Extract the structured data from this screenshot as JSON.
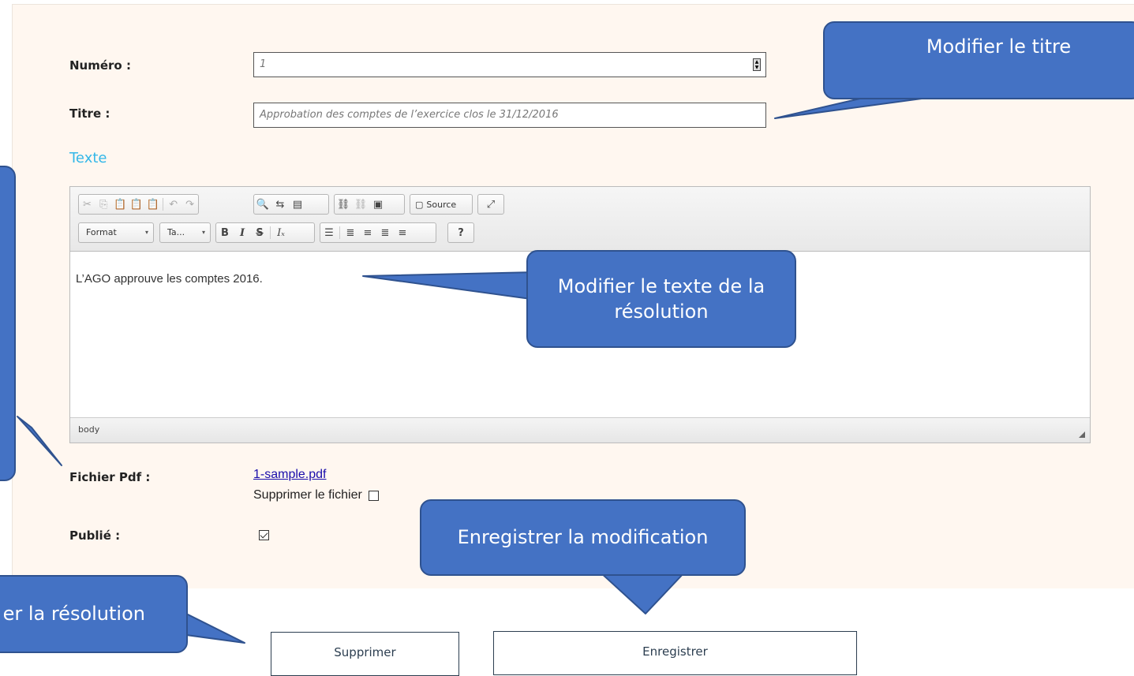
{
  "form": {
    "numero_label": "Numéro :",
    "numero_value": "1",
    "titre_label": "Titre :",
    "titre_value": "Approbation des comptes de l’exercice clos le  31/12/2016",
    "texte_heading": "Texte",
    "pdf_label": "Fichier Pdf :",
    "pdf_link": "1-sample.pdf",
    "delete_file_label": "Supprimer le fichier",
    "delete_file_checked": false,
    "publie_label": "Publié :",
    "publie_checked": true
  },
  "editor": {
    "format_combo": "Format",
    "style_combo": "Ta...",
    "source_label": "Source",
    "content": "L’AGO approuve les comptes 2016.",
    "status_path": "body",
    "toolbar_icons_row1": [
      "cut-icon",
      "copy-icon",
      "paste-icon",
      "paste-text-icon",
      "paste-word-icon",
      "undo-icon",
      "redo-icon",
      "find-icon",
      "replace-icon",
      "select-all-icon",
      "link-icon",
      "unlink-icon",
      "image-icon",
      "source-icon",
      "maximize-icon"
    ],
    "toolbar_icons_row2": [
      "bold-icon",
      "italic-icon",
      "strike-icon",
      "remove-format-icon",
      "bullet-list-icon",
      "align-left-icon",
      "align-center-icon",
      "align-right-icon",
      "justify-icon",
      "help-icon"
    ]
  },
  "buttons": {
    "supprimer": "Supprimer",
    "enregistrer": "Enregistrer"
  },
  "callouts": {
    "titre": "Modifier le titre",
    "texte_line1": "Modifier le texte de la",
    "texte_line2": "résolution",
    "enregistrer": "Enregistrer la modification",
    "supprimer": "er la résolution"
  },
  "colors": {
    "callout_fill": "#4472c4",
    "callout_border": "#2f528f",
    "panel_bg": "#fff7f0",
    "section_heading": "#33b7e8",
    "link": "#1a0dab"
  }
}
